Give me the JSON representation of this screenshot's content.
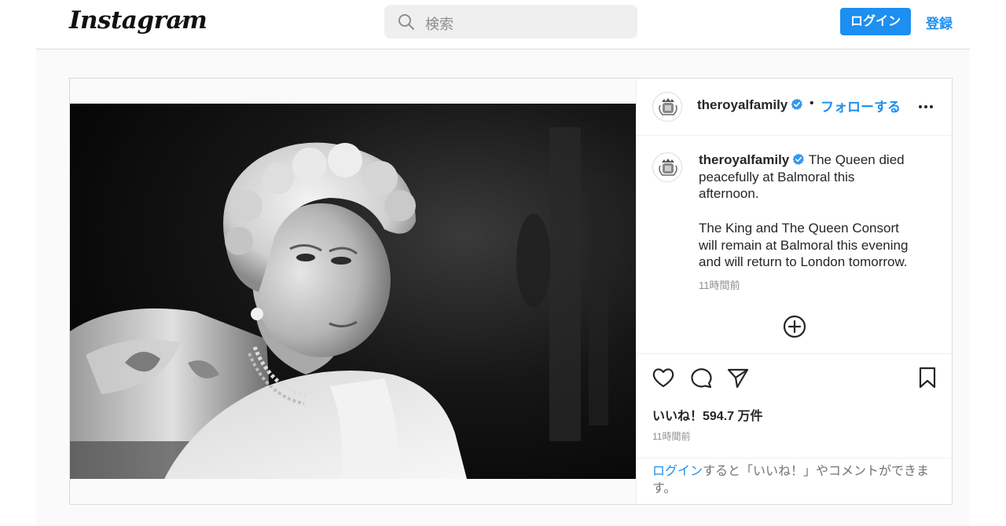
{
  "header": {
    "logo": "Instagram",
    "search_placeholder": "検索",
    "login_label": "ログイン",
    "signup_label": "登録"
  },
  "post": {
    "username": "theroyalfamily",
    "follow_label": "フォローする",
    "separator": "•",
    "caption_lines": [
      "The Queen died",
      "peacefully at Balmoral this",
      "afternoon."
    ],
    "caption_lines_2": [
      "The King and The Queen Consort",
      "will remain at Balmoral this evening",
      "and will return to London tomorrow."
    ],
    "caption_time": "11時間前",
    "likes": "いいね！594.7 万件",
    "post_time": "11時間前",
    "login_prompt_link": "ログイン",
    "login_prompt_rest": "すると「いいね！」やコメントができます。"
  },
  "colors": {
    "accent": "#1d8ff0",
    "text": "#262626",
    "muted": "#8e8e8e",
    "border": "#dbdbdb"
  },
  "icons": [
    "chevron-down-icon",
    "search-icon",
    "verified-icon",
    "more-icon",
    "add-comment-icon",
    "heart-icon",
    "comment-icon",
    "share-icon",
    "bookmark-icon"
  ]
}
